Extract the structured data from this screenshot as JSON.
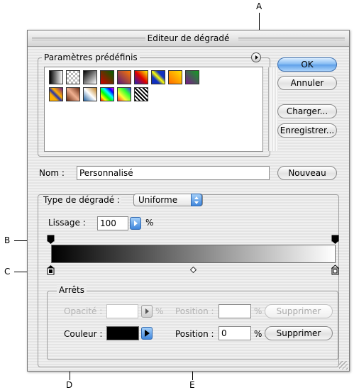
{
  "callouts": {
    "a": "A",
    "b": "B",
    "c": "C",
    "d": "D",
    "e": "E"
  },
  "dialog": {
    "title": "Editeur de dégradé",
    "presets": {
      "legend": "Paramètres prédéfinis",
      "swatches": [
        "black-white",
        "transparent-checker",
        "black-white-diag",
        "red-green",
        "violet-orange",
        "blue-red-yellow",
        "blue-yellow-blue",
        "orange-yellow",
        "violet-green",
        "blue-orange-stripe",
        "copper",
        "chrome",
        "rainbow-spectrum",
        "transparent-rainbow",
        "transparent-stripes"
      ]
    },
    "buttons": {
      "ok": "OK",
      "cancel": "Annuler",
      "load": "Charger...",
      "save": "Enregistrer...",
      "new": "Nouveau"
    },
    "name": {
      "label": "Nom :",
      "value": "Personnalisé"
    },
    "gradient_type": {
      "label": "Type de dégradé :",
      "selected": "Uniforme",
      "smoothness_label": "Lissage :",
      "smoothness_value": "100",
      "smoothness_unit": "%"
    },
    "stops": {
      "legend": "Arrêts",
      "opacity_label": "Opacité :",
      "opacity_value": "",
      "opacity_unit": "%",
      "position_label_1": "Position :",
      "position_value_1": "",
      "position_unit_1": "%",
      "delete_1": "Supprimer",
      "color_label": "Couleur :",
      "position_label_2": "Position :",
      "position_value_2": "0",
      "position_unit_2": "%",
      "delete_2": "Supprimer"
    },
    "gradient": {
      "start_color": "#000000",
      "end_color": "#ffffff",
      "midpoint": 0.5
    }
  }
}
